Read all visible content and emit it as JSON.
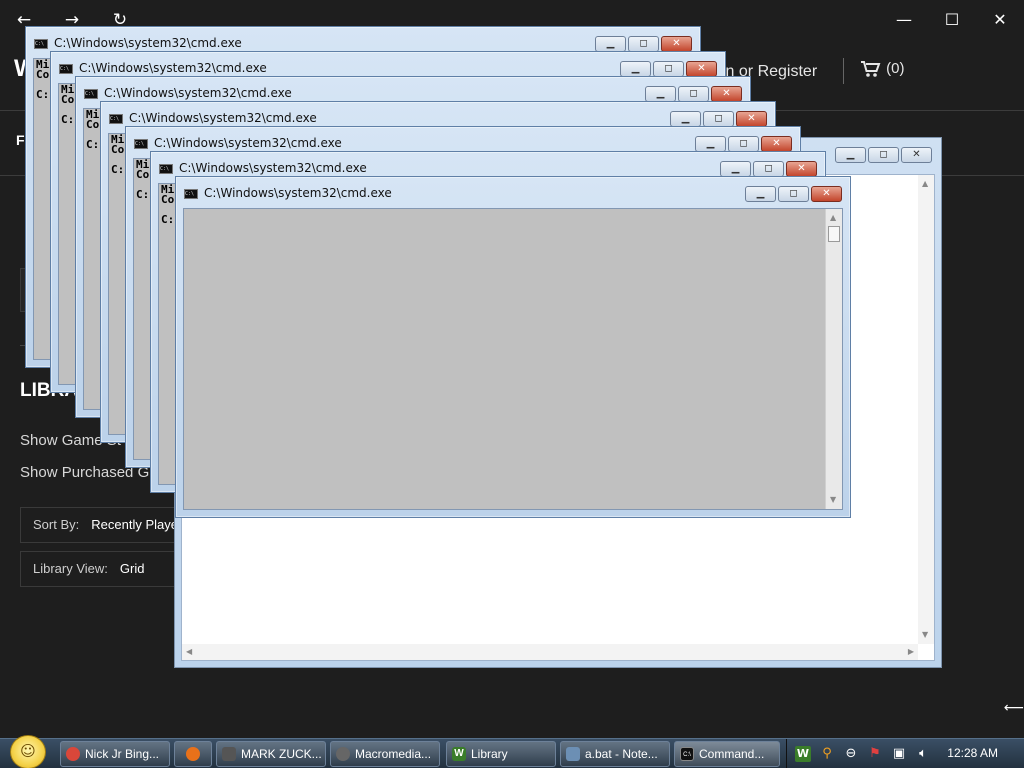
{
  "app": {
    "logo_letter": "W",
    "nav_initial": "F",
    "signin_label": "in or Register",
    "cart_count": "(0)",
    "library_heading": "LIBRA",
    "options": [
      "Show Game St",
      "Show Purchased G"
    ],
    "sort_by": {
      "label": "Sort By:",
      "value": "Recently Playe"
    },
    "library_view": {
      "label": "Library View:",
      "value": "Grid"
    }
  },
  "browser_nav": {
    "back": "←",
    "forward": "→",
    "reload": "↻"
  },
  "window_controls": {
    "minimize": "—",
    "maximize": "☐",
    "close": "✕"
  },
  "cmd": {
    "title": "C:\\Windows\\system32\\cmd.exe",
    "console_lines": [
      "Mi",
      "Co",
      "",
      "C:"
    ]
  },
  "caption_buttons": {
    "minimize": "▁",
    "maximize": "◻",
    "close": "✕"
  },
  "taskbar": {
    "items": [
      {
        "label": "Nick Jr Bing...",
        "icon": "chrome-icon",
        "color": "#d9473a"
      },
      {
        "label": "",
        "icon": "firefox-icon",
        "color": "#e8711a"
      },
      {
        "label": "MARK ZUCK...",
        "icon": "document-icon",
        "color": "#555555"
      },
      {
        "label": "Macromedia...",
        "icon": "macromedia-icon",
        "color": "#666666"
      },
      {
        "label": "Library",
        "icon": "w-app-icon",
        "color": "#3a7d2a"
      },
      {
        "label": "a.bat - Note...",
        "icon": "notepad-icon",
        "color": "#6c8fb4"
      },
      {
        "label": "Command...",
        "icon": "cmd-icon",
        "color": "#111111"
      }
    ],
    "clock": "12:28 AM"
  },
  "accent": {
    "start_orb": "#f4d24a",
    "close_red": "#c3452c"
  }
}
